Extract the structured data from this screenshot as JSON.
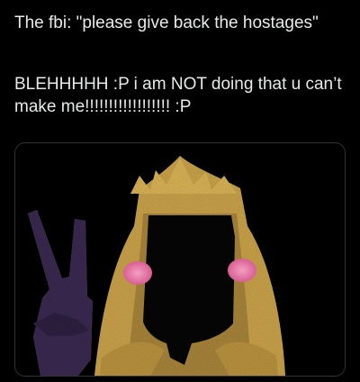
{
  "tweet": {
    "line1": "The fbi: \"please give back the hostages\"",
    "line2": "BLEHHHHH :P i am NOT doing that u can’t make me!!!!!!!!!!!!!!!!!! :P"
  },
  "image": {
    "subject_icon": "hooded-figure-with-crown",
    "colors": {
      "cloak": "#c9a24a",
      "cheek": "#e57aa5",
      "hand": "#3a2950",
      "background": "#000000"
    }
  }
}
